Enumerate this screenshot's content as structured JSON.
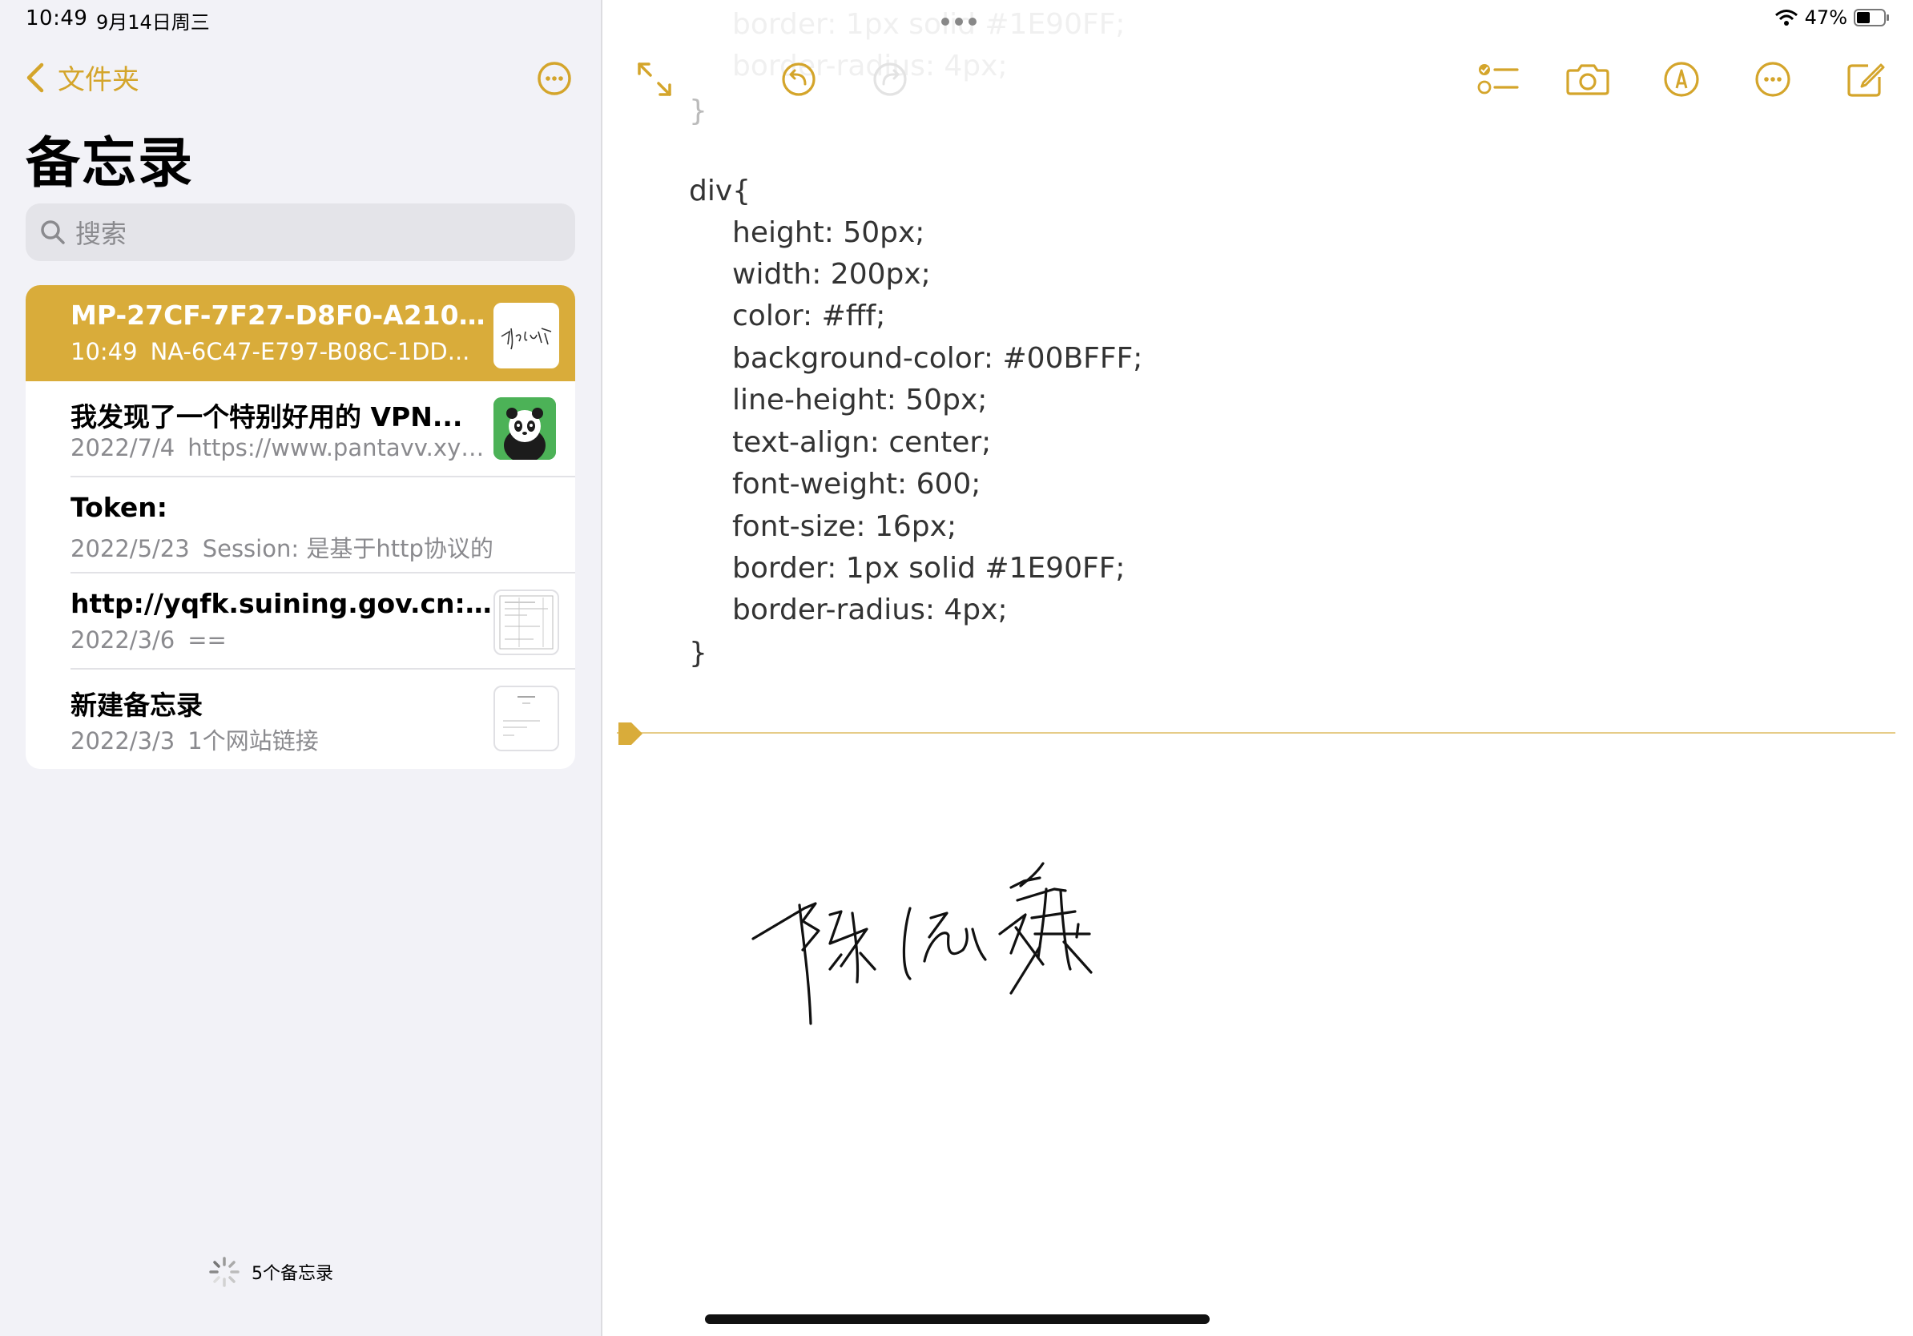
{
  "status": {
    "time": "10:49",
    "date": "9月14日周三",
    "battery": "47%",
    "battery_level": 0.47
  },
  "accent_color": "#d9ac3a",
  "sidebar": {
    "back_label": "文件夹",
    "title": "备忘录",
    "search_placeholder": "搜索",
    "footer_count": "5个备忘录",
    "notes": [
      {
        "title": "MP-27CF-7F27-D8F0-A2100...",
        "date": "10:49",
        "preview": "NA-6C47-E797-B08C-1DD...",
        "thumbnail": "signature-thumbnail",
        "selected": true
      },
      {
        "title": "我发现了一个特别好用的 VPN...",
        "date": "2022/7/4",
        "preview": "https://www.pantavv.xyz...",
        "thumbnail": "panda-app-thumbnail",
        "selected": false
      },
      {
        "title": "Token:",
        "date": "2022/5/23",
        "preview": "Session: 是基于http协议的",
        "thumbnail": "",
        "selected": false
      },
      {
        "title": "http://yqfk.suining.gov.cn:10...",
        "date": "2022/3/6",
        "preview": "==",
        "thumbnail": "document-thumbnail",
        "selected": false
      },
      {
        "title": "新建备忘录",
        "date": "2022/3/3",
        "preview": "1个网站链接",
        "thumbnail": "document-thumbnail",
        "selected": false
      }
    ]
  },
  "editor": {
    "ghost_lines": [
      "border: 1px solid #1E90FF;",
      "border-radius: 4px;"
    ],
    "closing_brace_top": "}",
    "selector": "div{",
    "declarations": [
      "height: 50px;",
      "width: 200px;",
      "color: #fff;",
      "background-color: #00BFFF;",
      "line-height: 50px;",
      "text-align: center;",
      "font-weight: 600;",
      "font-size: 16px;",
      "border: 1px solid #1E90FF;",
      "border-radius: 4px;"
    ],
    "closing_brace": "}",
    "signature": "handwritten-signature"
  }
}
